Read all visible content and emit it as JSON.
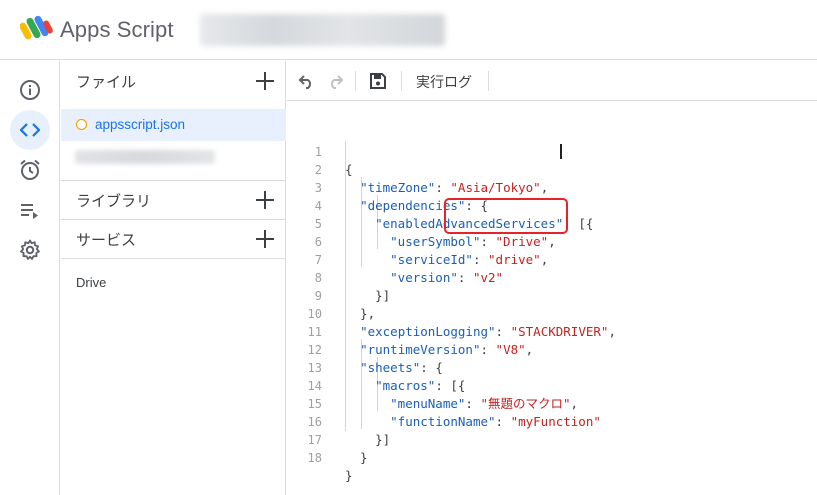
{
  "header": {
    "app_title": "Apps Script"
  },
  "rail": {
    "items": [
      {
        "icon": "info-icon",
        "active": false
      },
      {
        "icon": "code-icon",
        "active": true
      },
      {
        "icon": "alarm-icon",
        "active": false
      },
      {
        "icon": "executions-icon",
        "active": false
      },
      {
        "icon": "gear-icon",
        "active": false
      }
    ]
  },
  "sidebar": {
    "files_label": "ファイル",
    "active_file": "appsscript.json",
    "libraries_label": "ライブラリ",
    "services_label": "サービス",
    "service_entry": "Drive"
  },
  "toolbar": {
    "undo_icon": "undo-icon",
    "redo_icon": "redo-icon",
    "save_icon": "save-icon",
    "execution_log_label": "実行ログ"
  },
  "colors": {
    "accent": "#1a73e8",
    "active_bg": "#e8f0fe",
    "highlight_box": "#e8222a",
    "string_color": "#c5221f",
    "key_color": "#1a5fb4"
  },
  "code": {
    "line_numbers": [
      "1",
      "2",
      "3",
      "4",
      "5",
      "6",
      "7",
      "8",
      "9",
      "10",
      "11",
      "12",
      "13",
      "14",
      "15",
      "16",
      "17",
      "18"
    ],
    "lines": [
      "{",
      "  \"timeZone\": \"Asia/Tokyo\",",
      "  \"dependencies\": {",
      "    \"enabledAdvancedServices\": [{",
      "      \"userSymbol\": \"Drive\",",
      "      \"serviceId\": \"drive\",",
      "      \"version\": \"v2\"",
      "    }]",
      "  },",
      "  \"exceptionLogging\": \"STACKDRIVER\",",
      "  \"runtimeVersion\": \"V8\",",
      "  \"sheets\": {",
      "    \"macros\": [{",
      "      \"menuName\": \"無題のマクロ\",",
      "      \"functionName\": \"myFunction\"",
      "    }]",
      "  }",
      "}"
    ]
  }
}
